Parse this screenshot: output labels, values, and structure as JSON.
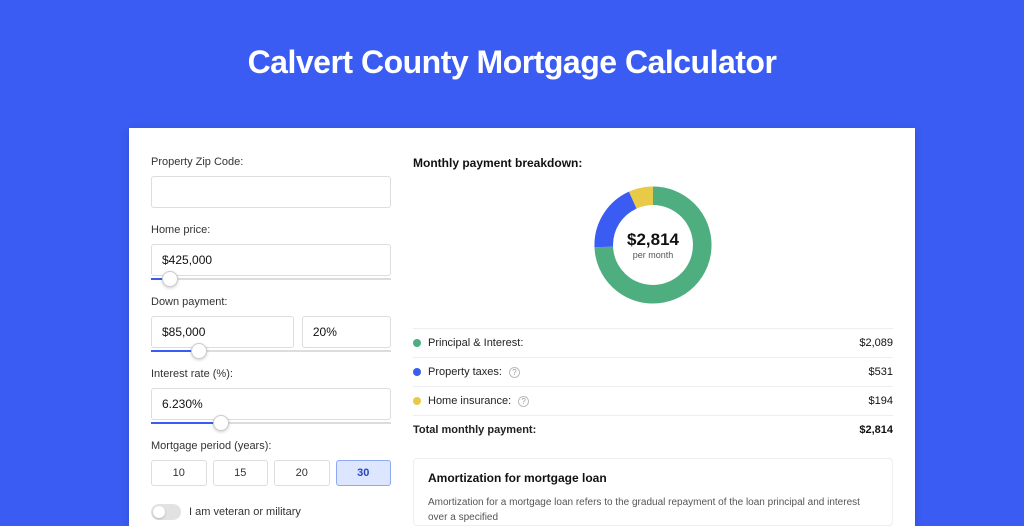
{
  "title": "Calvert County Mortgage Calculator",
  "form": {
    "zip_label": "Property Zip Code:",
    "zip_value": "",
    "home_price_label": "Home price:",
    "home_price_value": "$425,000",
    "home_price_slider_pct": 8,
    "down_payment_label": "Down payment:",
    "down_payment_value": "$85,000",
    "down_payment_pct_value": "20%",
    "down_payment_slider_pct": 20,
    "interest_label": "Interest rate (%):",
    "interest_value": "6.230%",
    "interest_slider_pct": 29,
    "period_label": "Mortgage period (years):",
    "period_options": [
      "10",
      "15",
      "20",
      "30"
    ],
    "period_selected": "30",
    "veteran_label": "I am veteran or military"
  },
  "breakdown": {
    "title": "Monthly payment breakdown:",
    "center_amount": "$2,814",
    "center_sub": "per month",
    "rows": [
      {
        "color": "green",
        "label": "Principal & Interest:",
        "info": false,
        "value": "$2,089"
      },
      {
        "color": "blue",
        "label": "Property taxes:",
        "info": true,
        "value": "$531"
      },
      {
        "color": "yellow",
        "label": "Home insurance:",
        "info": true,
        "value": "$194"
      }
    ],
    "total_label": "Total monthly payment:",
    "total_value": "$2,814"
  },
  "amort": {
    "title": "Amortization for mortgage loan",
    "text": "Amortization for a mortgage loan refers to the gradual repayment of the loan principal and interest over a specified"
  },
  "chart_data": {
    "type": "pie",
    "title": "Monthly payment breakdown",
    "series": [
      {
        "name": "Principal & Interest",
        "value": 2089,
        "color": "#4eae7f"
      },
      {
        "name": "Property taxes",
        "value": 531,
        "color": "#3a5cf2"
      },
      {
        "name": "Home insurance",
        "value": 194,
        "color": "#e9c948"
      }
    ],
    "total": 2814
  }
}
